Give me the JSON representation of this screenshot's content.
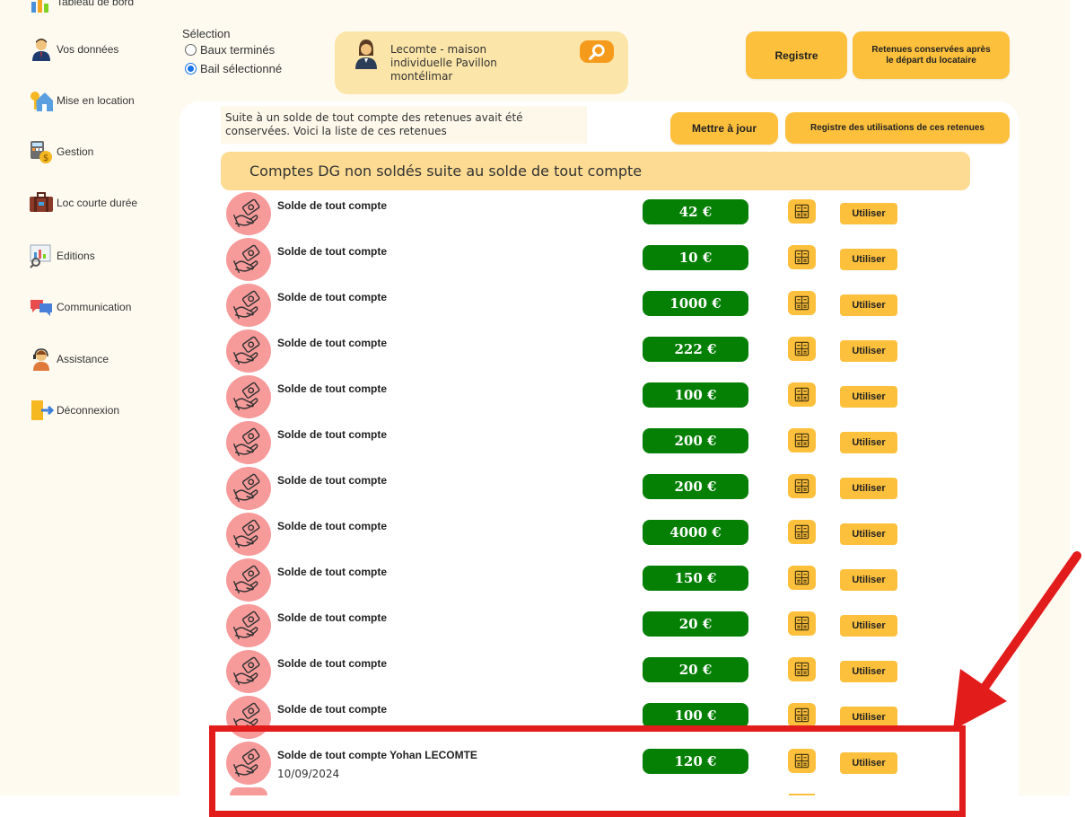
{
  "sidebar": {
    "items": [
      {
        "label": "Tableau de bord",
        "icon": "dashboard-icon"
      },
      {
        "label": "Vos données",
        "icon": "user-icon"
      },
      {
        "label": "Mise en location",
        "icon": "house-key-icon"
      },
      {
        "label": "Gestion",
        "icon": "calculator-money-icon"
      },
      {
        "label": "Loc courte durée",
        "icon": "suitcase-icon"
      },
      {
        "label": "Editions",
        "icon": "report-icon"
      },
      {
        "label": "Communication",
        "icon": "chat-bubbles-icon"
      },
      {
        "label": "Assistance",
        "icon": "support-agent-icon"
      },
      {
        "label": "Déconnexion",
        "icon": "logout-door-icon"
      }
    ]
  },
  "selection": {
    "label": "Sélection",
    "options": [
      {
        "label": "Baux terminés",
        "checked": false
      },
      {
        "label": "Bail sélectionné",
        "checked": true
      }
    ]
  },
  "tenant": {
    "line1": "Lecomte - maison",
    "line2": "individuelle Pavillon",
    "line3": "montélimar"
  },
  "header_buttons": {
    "registre": "Registre",
    "retenues_line1": "Retenues conservées après",
    "retenues_line2": "le départ du locataire"
  },
  "intro": {
    "line1": "Suite à un solde de tout compte des retenues avait été",
    "line2": "conservées. Voici la liste de ces retenues"
  },
  "actions": {
    "update": "Mettre à jour",
    "register_usage": "Registre des utilisations de ces retenues"
  },
  "section_title": "Comptes DG non soldés suite au solde de tout compte",
  "rows": [
    {
      "label": "Solde de tout compte",
      "amount": "42 €",
      "date": "",
      "action": "Utiliser"
    },
    {
      "label": "Solde de tout compte",
      "amount": "10 €",
      "date": "",
      "action": "Utiliser"
    },
    {
      "label": "Solde de tout compte",
      "amount": "1000 €",
      "date": "",
      "action": "Utiliser"
    },
    {
      "label": "Solde de tout compte",
      "amount": "222 €",
      "date": "",
      "action": "Utiliser"
    },
    {
      "label": "Solde de tout compte",
      "amount": "100 €",
      "date": "",
      "action": "Utiliser"
    },
    {
      "label": "Solde de tout compte",
      "amount": "200 €",
      "date": "",
      "action": "Utiliser"
    },
    {
      "label": "Solde de tout compte",
      "amount": "200 €",
      "date": "",
      "action": "Utiliser"
    },
    {
      "label": "Solde de tout compte",
      "amount": "4000 €",
      "date": "",
      "action": "Utiliser"
    },
    {
      "label": "Solde de tout compte",
      "amount": "150 €",
      "date": "",
      "action": "Utiliser"
    },
    {
      "label": "Solde de tout compte",
      "amount": "20 €",
      "date": "",
      "action": "Utiliser"
    },
    {
      "label": "Solde de tout compte",
      "amount": "20 €",
      "date": "",
      "action": "Utiliser"
    },
    {
      "label": "Solde de tout compte",
      "amount": "100 €",
      "date": "",
      "action": "Utiliser"
    },
    {
      "label": "Solde de tout compte Yohan LECOMTE",
      "amount": "120 €",
      "date": "10/09/2024",
      "action": "Utiliser"
    }
  ],
  "colors": {
    "accent_yellow": "#fdc03c",
    "amount_green": "#058005",
    "icon_pink": "#f79a9a",
    "highlight_red": "#e21b1b"
  }
}
